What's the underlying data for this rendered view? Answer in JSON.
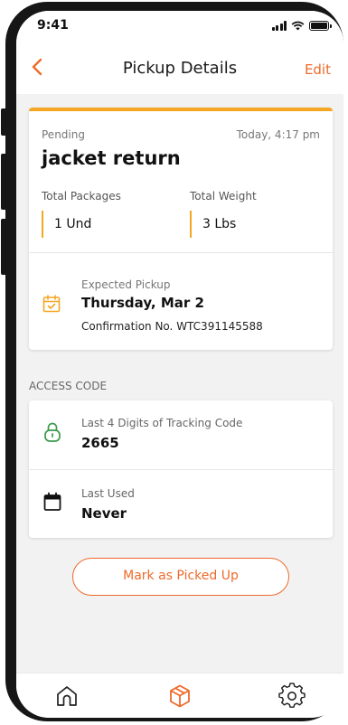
{
  "status_bar": {
    "time": "9:41"
  },
  "header": {
    "title": "Pickup Details",
    "edit_label": "Edit"
  },
  "pickup": {
    "status": "Pending",
    "timestamp": "Today, 4:17 pm",
    "title": "jacket return",
    "packages_label": "Total Packages",
    "packages_value": "1 Und",
    "weight_label": "Total Weight",
    "weight_value": "3 Lbs",
    "expected_label": "Expected Pickup",
    "expected_date": "Thursday, Mar 2",
    "confirmation": "Confirmation No. WTC391145588"
  },
  "access_code": {
    "section_title": "ACCESS CODE",
    "tracking_label": "Last 4 Digits of Tracking Code",
    "tracking_value": "2665",
    "last_used_label": "Last Used",
    "last_used_value": "Never"
  },
  "action": {
    "mark_picked_up_label": "Mark as Picked Up"
  },
  "tabs": [
    {
      "icon": "home-icon",
      "active": false
    },
    {
      "icon": "package-icon",
      "active": true
    },
    {
      "icon": "settings-icon",
      "active": false
    }
  ],
  "colors": {
    "accent": "#ee6a2a",
    "pending": "#f5a623",
    "lock": "#3a9a4a",
    "background": "#f2f2f2"
  }
}
